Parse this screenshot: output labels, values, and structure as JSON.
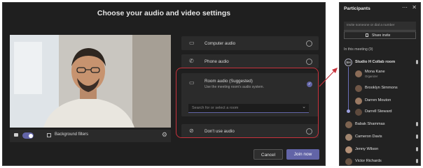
{
  "dialog": {
    "title": "Choose your audio and video settings",
    "background_filters_label": "Background filters",
    "options": [
      {
        "label": "Computer audio",
        "suffix": "",
        "desc": "",
        "selected": false
      },
      {
        "label": "Phone audio",
        "suffix": "",
        "desc": "",
        "selected": false
      },
      {
        "label": "Room audio",
        "suffix": " (Suggested)",
        "desc": "Use the meeting room's audio system.",
        "selected": true
      },
      {
        "label": "Don't use audio",
        "suffix": "",
        "desc": "",
        "selected": false
      }
    ],
    "room_search_placeholder": "Search for or select a room",
    "cancel_label": "Cancel",
    "join_label": "Join now",
    "accent": "#6264a7",
    "highlight": "#c8323c"
  },
  "panel": {
    "title": "Participants",
    "invite_placeholder": "Invite someone or dial a number",
    "share_invite_label": "Share invite",
    "section_label": "In this meeting (9)",
    "room": {
      "initials": "SH",
      "name": "Studio H Collab room"
    },
    "room_members": [
      {
        "name": "Mona Kane",
        "role": "Organizer"
      },
      {
        "name": "Brooklyn Simmons",
        "role": ""
      },
      {
        "name": "Darren Mouton",
        "role": ""
      },
      {
        "name": "Darrell Steward",
        "role": ""
      }
    ],
    "others": [
      {
        "name": "Babak Shammas"
      },
      {
        "name": "Cameron Davis"
      },
      {
        "name": "Jenny Wilson"
      },
      {
        "name": "Victor Richards"
      }
    ]
  }
}
